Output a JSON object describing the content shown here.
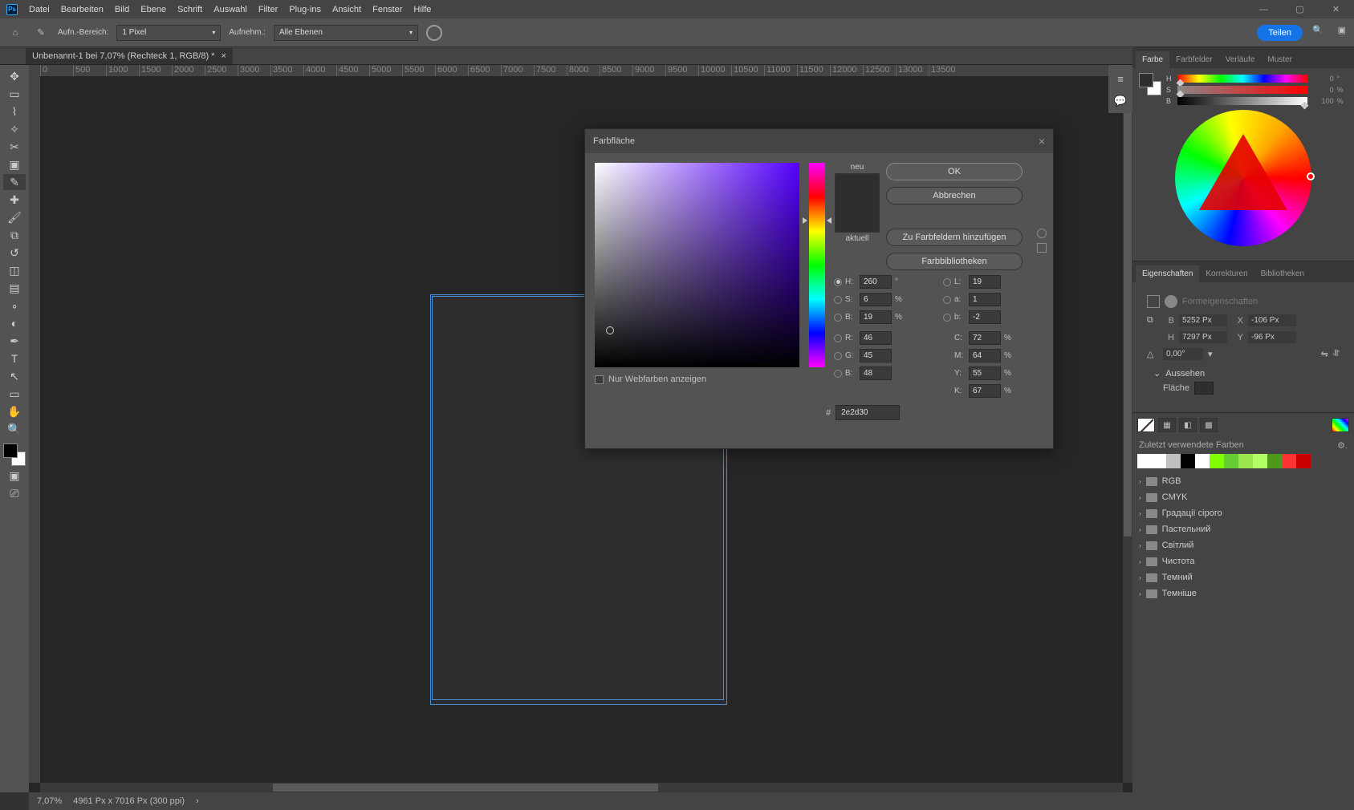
{
  "menu": [
    "Datei",
    "Bearbeiten",
    "Bild",
    "Ebene",
    "Schrift",
    "Auswahl",
    "Filter",
    "Plug-ins",
    "Ansicht",
    "Fenster",
    "Hilfe"
  ],
  "options": {
    "sample_label": "Aufn.-Bereich:",
    "sample_value": "1 Pixel",
    "record_label": "Aufnehm.:",
    "layers_value": "Alle Ebenen",
    "share": "Teilen"
  },
  "tab": {
    "title": "Unbenannt-1 bei 7,07% (Rechteck 1, RGB/8) *"
  },
  "ruler_marks": [
    "0",
    "500",
    "1000",
    "1500",
    "2000",
    "2500",
    "3000",
    "3500",
    "4000",
    "4500",
    "5000",
    "5500",
    "6000",
    "6500",
    "7000",
    "7500",
    "8000",
    "8500",
    "9000",
    "9500",
    "10000",
    "10500",
    "11000",
    "11500",
    "12000",
    "12500",
    "13000",
    "13500"
  ],
  "status": {
    "zoom": "7,07%",
    "info": "4961 Px x 7016 Px (300 ppi)"
  },
  "color_tabs": [
    "Farbe",
    "Farbfelder",
    "Verläufe",
    "Muster"
  ],
  "color_sliders": {
    "H": "0",
    "S": "0",
    "B": "100"
  },
  "props_tabs": [
    "Eigenschaften",
    "Korrekturen",
    "Bibliotheken"
  ],
  "props": {
    "subtitle": "Formeigenschaften",
    "B": "5252 Px",
    "H": "7297 Px",
    "X": "-106 Px",
    "Y": "-96 Px",
    "angle": "0,00°",
    "appearance_title": "Aussehen",
    "fill_label": "Fläche"
  },
  "swatches": {
    "recent_label": "Zuletzt verwendete Farben",
    "recent": [
      "#ffffff",
      "#ffffff",
      "#bfbfbf",
      "#000000",
      "#ffffff",
      "#7fff00",
      "#66cc33",
      "#99e64d",
      "#b3ff66",
      "#4d991a",
      "#ff3333",
      "#cc0000"
    ],
    "folders": [
      "RGB",
      "CMYK",
      "Градації сірого",
      "Пастельний",
      "Світлий",
      "Чистота",
      "Темний",
      "Темніше"
    ]
  },
  "picker": {
    "title": "Farbfläche",
    "new_label": "neu",
    "current_label": "aktuell",
    "buttons": {
      "ok": "OK",
      "cancel": "Abbrechen",
      "add": "Zu Farbfeldern hinzufügen",
      "libs": "Farbbibliotheken"
    },
    "webonly": "Nur Webfarben anzeigen",
    "H": "260",
    "S": "6",
    "Bv": "19",
    "L": "19",
    "a": "1",
    "b": "-2",
    "R": "46",
    "G": "45",
    "Bb": "48",
    "C": "72",
    "M": "64",
    "Y": "55",
    "K": "67",
    "hex": "2e2d30",
    "new_color": "#2e2d30",
    "cur_color": "#2e2d30"
  }
}
